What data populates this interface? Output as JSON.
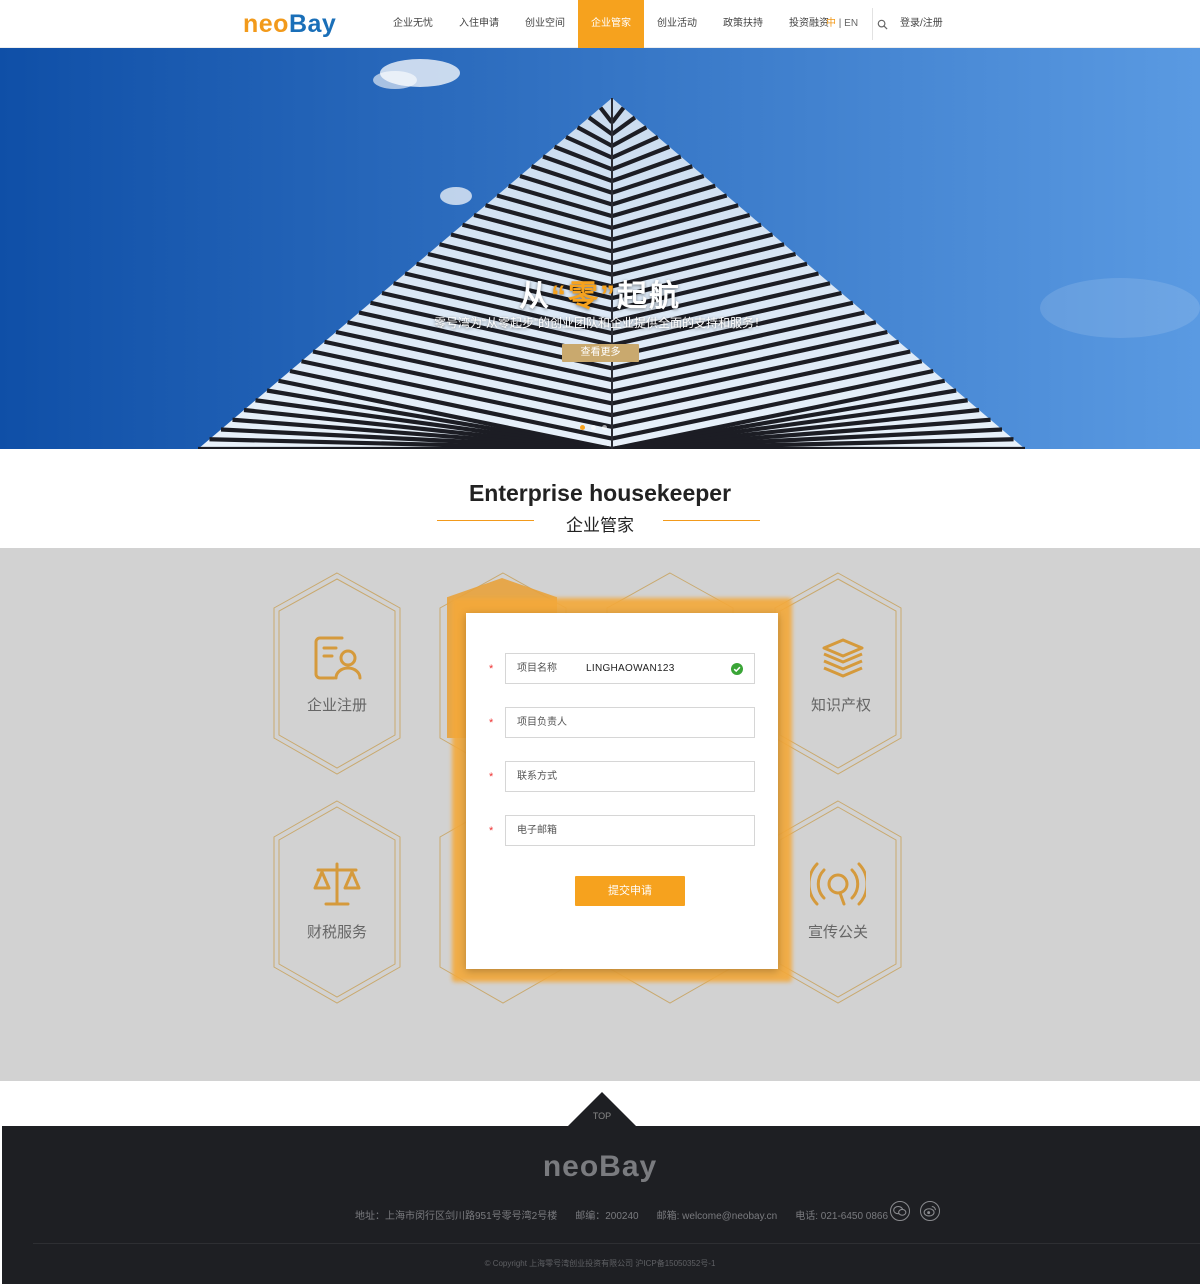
{
  "nav": {
    "logo_neo": "neo",
    "logo_bay": "Bay",
    "items": [
      {
        "label": "企业无忧"
      },
      {
        "label": "入住申请"
      },
      {
        "label": "创业空间"
      },
      {
        "label": "企业管家"
      },
      {
        "label": "创业活动"
      },
      {
        "label": "政策扶持"
      },
      {
        "label": "投资融资"
      }
    ],
    "active_index": 3,
    "lang_zh": "中",
    "lang_sep": " | ",
    "lang_en": "EN",
    "search_icon": "search-icon",
    "login": "登录/注册"
  },
  "hero": {
    "title_pre": "从",
    "title_hl": "“零”",
    "title_post": "起航",
    "subtitle": "零号湾为“从零起步”的创业团队和企业提供全面的支持和服务！",
    "button": "查看更多",
    "slides": 3,
    "active_slide": 1
  },
  "section": {
    "title_en": "Enterprise housekeeper",
    "title_zh": "企业管家"
  },
  "services": [
    {
      "label": "企业注册",
      "icon": "registration-icon"
    },
    {
      "label": "知识产权",
      "icon": "books-icon"
    },
    {
      "label": "财税服务",
      "icon": "scale-icon"
    },
    {
      "label": "宣传公关",
      "icon": "broadcast-icon"
    }
  ],
  "form": {
    "fields": [
      {
        "label": "项目名称",
        "value": "LINGHAOWAN123",
        "valid": true
      },
      {
        "label": "项目负责人",
        "value": ""
      },
      {
        "label": "联系方式",
        "value": ""
      },
      {
        "label": "电子邮箱",
        "value": ""
      }
    ],
    "required_mark": "*",
    "submit": "提交申请"
  },
  "footer": {
    "top": "TOP",
    "logo": "neoBay",
    "address": "地址：上海市闵行区剑川路951号零号湾2号楼",
    "postcode": "邮编：200240",
    "email": "邮箱: welcome@neobay.cn",
    "phone": "电话: 021-6450 0866",
    "social": [
      "wechat-icon",
      "weibo-icon"
    ],
    "copyright": "© Copyright 上海零号湾创业投资有限公司 沪ICP备15050352号-1"
  },
  "colors": {
    "accent": "#f6a21e",
    "brand_blue": "#1a6fb8",
    "gold": "#c9a96e",
    "footer_bg": "#1e1f23"
  }
}
